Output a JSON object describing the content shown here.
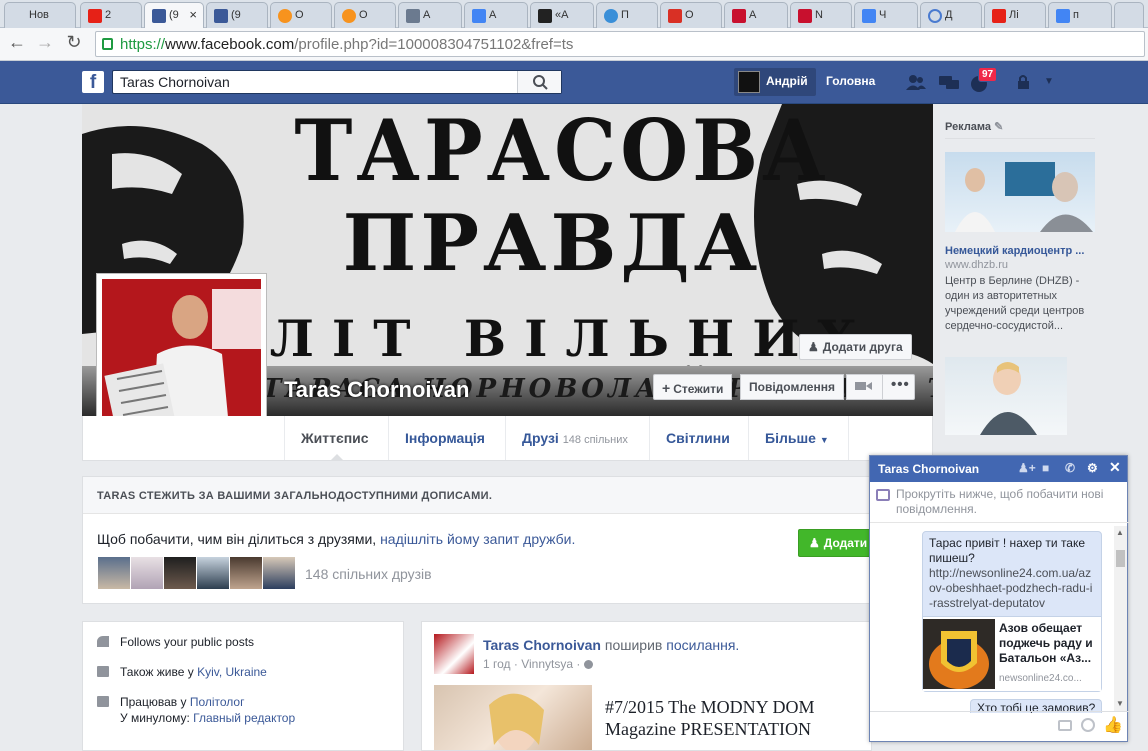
{
  "browser": {
    "tabs": [
      {
        "title": "Нов",
        "icon": "none"
      },
      {
        "title": "2",
        "icon": "youtube-icon"
      },
      {
        "title": "(9",
        "icon": "facebook-icon",
        "active": true
      },
      {
        "title": "(9",
        "icon": "facebook-icon"
      },
      {
        "title": "О",
        "icon": "odnoklassniki-icon"
      },
      {
        "title": "О",
        "icon": "odnoklassniki-icon"
      },
      {
        "title": "А",
        "icon": "mail-icon"
      },
      {
        "title": "А",
        "icon": "google-icon"
      },
      {
        "title": "«А",
        "icon": "ap-icon"
      },
      {
        "title": "П",
        "icon": "flower-icon"
      },
      {
        "title": "О",
        "icon": "gmail-icon"
      },
      {
        "title": "А",
        "icon": "24-icon"
      },
      {
        "title": "N",
        "icon": "24-icon"
      },
      {
        "title": "Ч",
        "icon": "google-icon"
      },
      {
        "title": "Д",
        "icon": "loading-icon"
      },
      {
        "title": "Лі",
        "icon": "youtube-icon"
      },
      {
        "title": "п",
        "icon": "google-icon"
      }
    ],
    "url_scheme": "https://",
    "url_host": "www.facebook.com",
    "url_path": "/profile.php?id=100008304751102&fref=ts"
  },
  "fb": {
    "search_value": "Taras  Chornoivan",
    "user_name": "Андрій",
    "home_label": "Головна",
    "notif_count": "97"
  },
  "profile": {
    "cover_line1": "ТАРАСОВА",
    "cover_line2": "ПРАВДА",
    "cover_line3": "ЛІТ ВІЛЬНИХ ЛЮДЕЙ",
    "cover_bottom": "ТАРАСА ЧОРНОВОЛА ЧОРНОВАНИ ТАРАС",
    "name": "Taras Chornoivan",
    "add_friend": "Додати друга",
    "follow": "Стежити",
    "message": "Повідомлення",
    "tabs": [
      {
        "label": "Життєпис",
        "count": ""
      },
      {
        "label": "Інформація",
        "count": ""
      },
      {
        "label": "Друзі",
        "count": "148 спільних"
      },
      {
        "label": "Світлини",
        "count": ""
      },
      {
        "label": "Більше",
        "count": ""
      }
    ]
  },
  "follow_box": {
    "header": "TARAS СТЕЖИТЬ ЗА ВАШИМИ ЗАГАЛЬНОДОСТУПНИМИ ДОПИСАМИ.",
    "text": "Щоб побачити, чим він ділиться з друзями, ",
    "link": "надішліть йому запит дружби.",
    "mutual": "148 спільних друзів",
    "add_button": "Додати"
  },
  "intro": {
    "follows": "Follows your public posts",
    "lives_prefix": "Також живе у ",
    "lives_link": "Kyiv, Ukraine",
    "worked_prefix": "Працював у ",
    "worked_link": "Політолог",
    "previously_prefix": "У минулому: ",
    "previously_link": "Главный редактор"
  },
  "post": {
    "author": "Taras Chornoivan",
    "action": " поширив ",
    "action_link": "посилання.",
    "meta": "1 год · Vinnytsya ·",
    "link_title": "#7/2015 The MODNY DOM Magazine PRESENTATION"
  },
  "ads": {
    "label": "Реклама",
    "ad1_title": "Немецкий кардиоцентр ...",
    "ad1_domain": "www.dhzb.ru",
    "ad1_text": "Центр в Берлине (DHZB) - один из авторитетных учреждений среди центров сердечно-сосудистой..."
  },
  "chat": {
    "title": "Taras Chornoivan",
    "note": "Прокрутіть нижче, щоб побачити нові повідомлення.",
    "msg": "Тарас привіт  ! нахер ти таке пишеш?",
    "msg_link": "http://newsonline24.com.ua/azov-obeshhaet-podzhech-radu-i-rasstrelyat-deputatov",
    "preview_title": "Азов обещает подж­ечь раду и Батальон «Аз...",
    "preview_domain": "newsonline24.co...",
    "next_msg": "Хто тобі це замовив?"
  },
  "colors": {
    "fb_blue": "#3b5998",
    "link": "#365899",
    "green": "#42b72a",
    "badge": "#f02849"
  }
}
